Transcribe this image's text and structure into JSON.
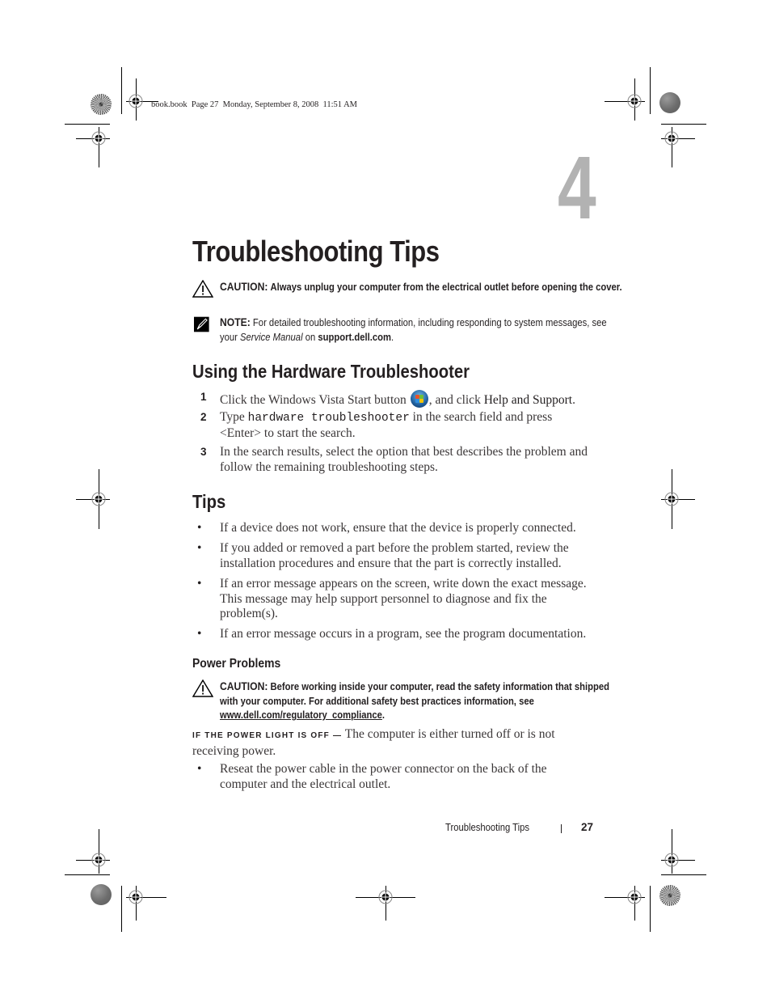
{
  "header": {
    "slug": "book.book  Page 27  Monday, September 8, 2008  11:51 AM"
  },
  "chapter": {
    "number": "4",
    "title": "Troubleshooting Tips"
  },
  "notices": {
    "caution1": {
      "label": "CAUTION:",
      "text": "Always unplug your computer from the electrical outlet before opening the cover."
    },
    "note1": {
      "label": "NOTE:",
      "text_before": "For detailed troubleshooting information, including responding to system messages, see your",
      "manual": "Service Manual",
      "text_on": "on",
      "site": "support.dell.com",
      "end": "."
    }
  },
  "hardware_troubleshooter": {
    "heading": "Using the Hardware Troubleshooter",
    "steps": [
      {
        "num": "1",
        "text_before": "Click the Windows Vista Start button",
        "text_after": ", and click",
        "emph": "Help and Support",
        "end": "."
      },
      {
        "num": "2",
        "text_before": "Type",
        "code": "hardware troubleshooter",
        "text_after": "in the search field and press <Enter> to start the search."
      },
      {
        "num": "3",
        "text": "In the search results, select the option that best describes the problem and follow the remaining troubleshooting steps."
      }
    ]
  },
  "tips": {
    "heading": "Tips",
    "bullet": "•",
    "items": [
      "If a device does not work, ensure that the device is properly connected.",
      "If you added or removed a part before the problem started, review the installation procedures and ensure that the part is correctly installed.",
      "If an error message appears on the screen, write down the exact message. This message may help support personnel to diagnose and fix the problem(s).",
      "If an error message occurs in a program, see the program documentation."
    ]
  },
  "power_problems": {
    "heading": "Power Problems",
    "caution": {
      "label": "CAUTION:",
      "text": "Before working inside your computer, read the safety information that shipped with your computer. For additional safety best practices information, see",
      "link": "www.dell.com/regulatory_compliance",
      "end": "."
    },
    "condition": {
      "label": "If the power light is off —",
      "text": "The computer is either turned off or is not receiving power."
    },
    "items": [
      "Reseat the power cable in the power connector on the back of the computer and the electrical outlet."
    ]
  },
  "footer": {
    "section": "Troubleshooting Tips",
    "page": "27"
  },
  "icons": {
    "caution": "warning-triangle-icon",
    "note": "pencil-note-icon",
    "vista_start": "windows-vista-start-icon"
  }
}
